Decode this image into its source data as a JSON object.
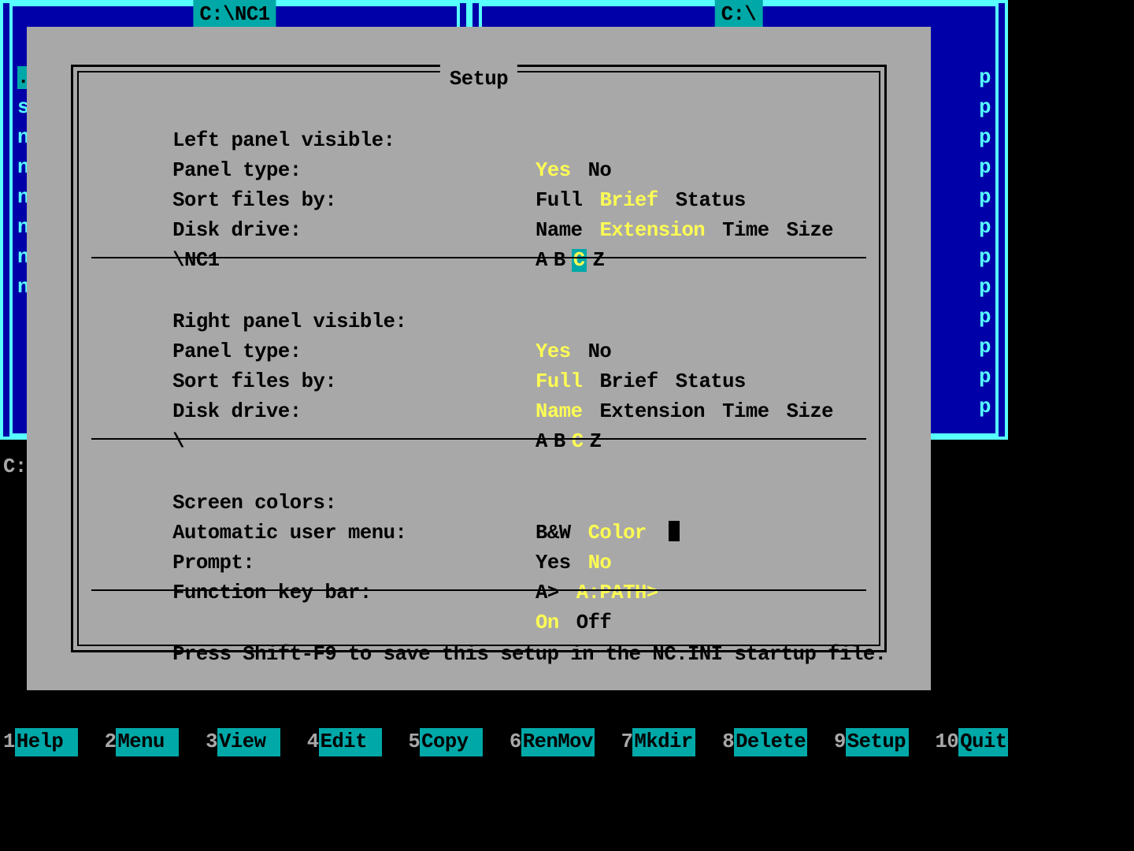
{
  "left_panel": {
    "title": "C:\\NC1",
    "files": [
      ".",
      "s",
      "n",
      "n",
      "n",
      "n",
      "n",
      "n"
    ]
  },
  "right_panel": {
    "title": "C:\\",
    "files": [
      "p",
      "p",
      "p",
      "p",
      "p",
      "p",
      "p",
      "p",
      "p",
      "p",
      "p",
      "p"
    ]
  },
  "prompt": "C:",
  "dialog": {
    "title": "Setup",
    "left": {
      "vis_label": "Left panel visible:",
      "vis": [
        "Yes",
        "No"
      ],
      "vis_sel": 0,
      "type_label": "Panel type:",
      "types": [
        "Full",
        "Brief",
        "Status"
      ],
      "type_sel": 1,
      "sort_label": "Sort files by:",
      "sorts": [
        "Name",
        "Extension",
        "Time",
        "Size"
      ],
      "sort_sel": 1,
      "drive_label": "Disk drive:",
      "drives": [
        "A",
        "B",
        "C",
        "Z"
      ],
      "drive_sel": 2,
      "drive_hl": true,
      "path": "\\NC1"
    },
    "right": {
      "vis_label": "Right panel visible:",
      "vis": [
        "Yes",
        "No"
      ],
      "vis_sel": 0,
      "type_label": "Panel type:",
      "types": [
        "Full",
        "Brief",
        "Status"
      ],
      "type_sel": 0,
      "sort_label": "Sort files by:",
      "sorts": [
        "Name",
        "Extension",
        "Time",
        "Size"
      ],
      "sort_sel": 0,
      "drive_label": "Disk drive:",
      "drives": [
        "A",
        "B",
        "C",
        "Z"
      ],
      "drive_sel": 2,
      "drive_hl": false,
      "path": "\\"
    },
    "misc": {
      "colors_label": "Screen colors:",
      "colors": [
        "B&W",
        "Color"
      ],
      "colors_sel": 1,
      "cursor_after": true,
      "auto_label": "Automatic user menu:",
      "auto": [
        "Yes",
        "No"
      ],
      "auto_sel": 1,
      "prompt_label": "Prompt:",
      "prompts": [
        "A>",
        "A:PATH>"
      ],
      "prompt_sel": 1,
      "fk_label": "Function key bar:",
      "fk": [
        "On",
        "Off"
      ],
      "fk_sel": 0
    },
    "hint": "Press Shift-F9 to save this setup in the NC.INI startup file."
  },
  "fkeys": [
    {
      "n": "1",
      "l": "Help"
    },
    {
      "n": "2",
      "l": "Menu"
    },
    {
      "n": "3",
      "l": "View"
    },
    {
      "n": "4",
      "l": "Edit"
    },
    {
      "n": "5",
      "l": "Copy"
    },
    {
      "n": "6",
      "l": "RenMov"
    },
    {
      "n": "7",
      "l": "Mkdir"
    },
    {
      "n": "8",
      "l": "Delete"
    },
    {
      "n": "9",
      "l": "Setup"
    },
    {
      "n": "10",
      "l": "Quit"
    }
  ]
}
